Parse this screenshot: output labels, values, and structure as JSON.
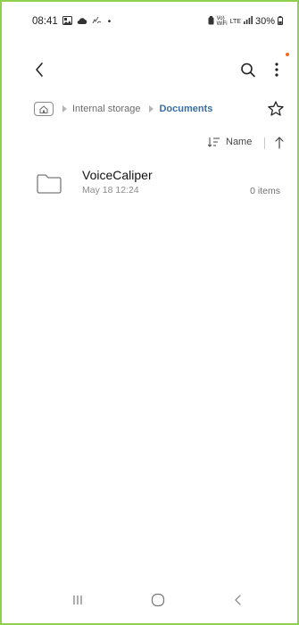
{
  "status_bar": {
    "time": "08:41",
    "left_icons": [
      "gallery-icon",
      "cloud-icon",
      "wifi-calling-icon"
    ],
    "dot": "•",
    "right_icons": [
      "battery-saver-icon",
      "vowifi-icon",
      "lte-icon",
      "signal-icon"
    ],
    "vowifi_label": "Vo) WiFi",
    "lte_label": "LTE",
    "battery": "30%"
  },
  "top_bar": {
    "back_icon": "back-arrow-icon",
    "search_icon": "search-icon",
    "more_icon": "more-vert-icon",
    "notification_dot_color": "#f26b1d"
  },
  "breadcrumb": {
    "home_icon": "home-icon",
    "items": [
      "Internal storage",
      "Documents"
    ]
  },
  "favorite_icon": "star-outline-icon",
  "sort": {
    "icon": "sort-icon",
    "label": "Name",
    "direction_icon": "arrow-up-icon"
  },
  "files": [
    {
      "name": "VoiceCaliper",
      "date": "May 18 12:24",
      "count": "0 items",
      "icon": "folder-icon"
    }
  ],
  "nav": {
    "recents_icon": "recents-icon",
    "home_icon": "home-circle-icon",
    "back_icon": "nav-back-icon"
  },
  "colors": {
    "accent": "#3a6ea5",
    "frame": "#8fd14f"
  }
}
